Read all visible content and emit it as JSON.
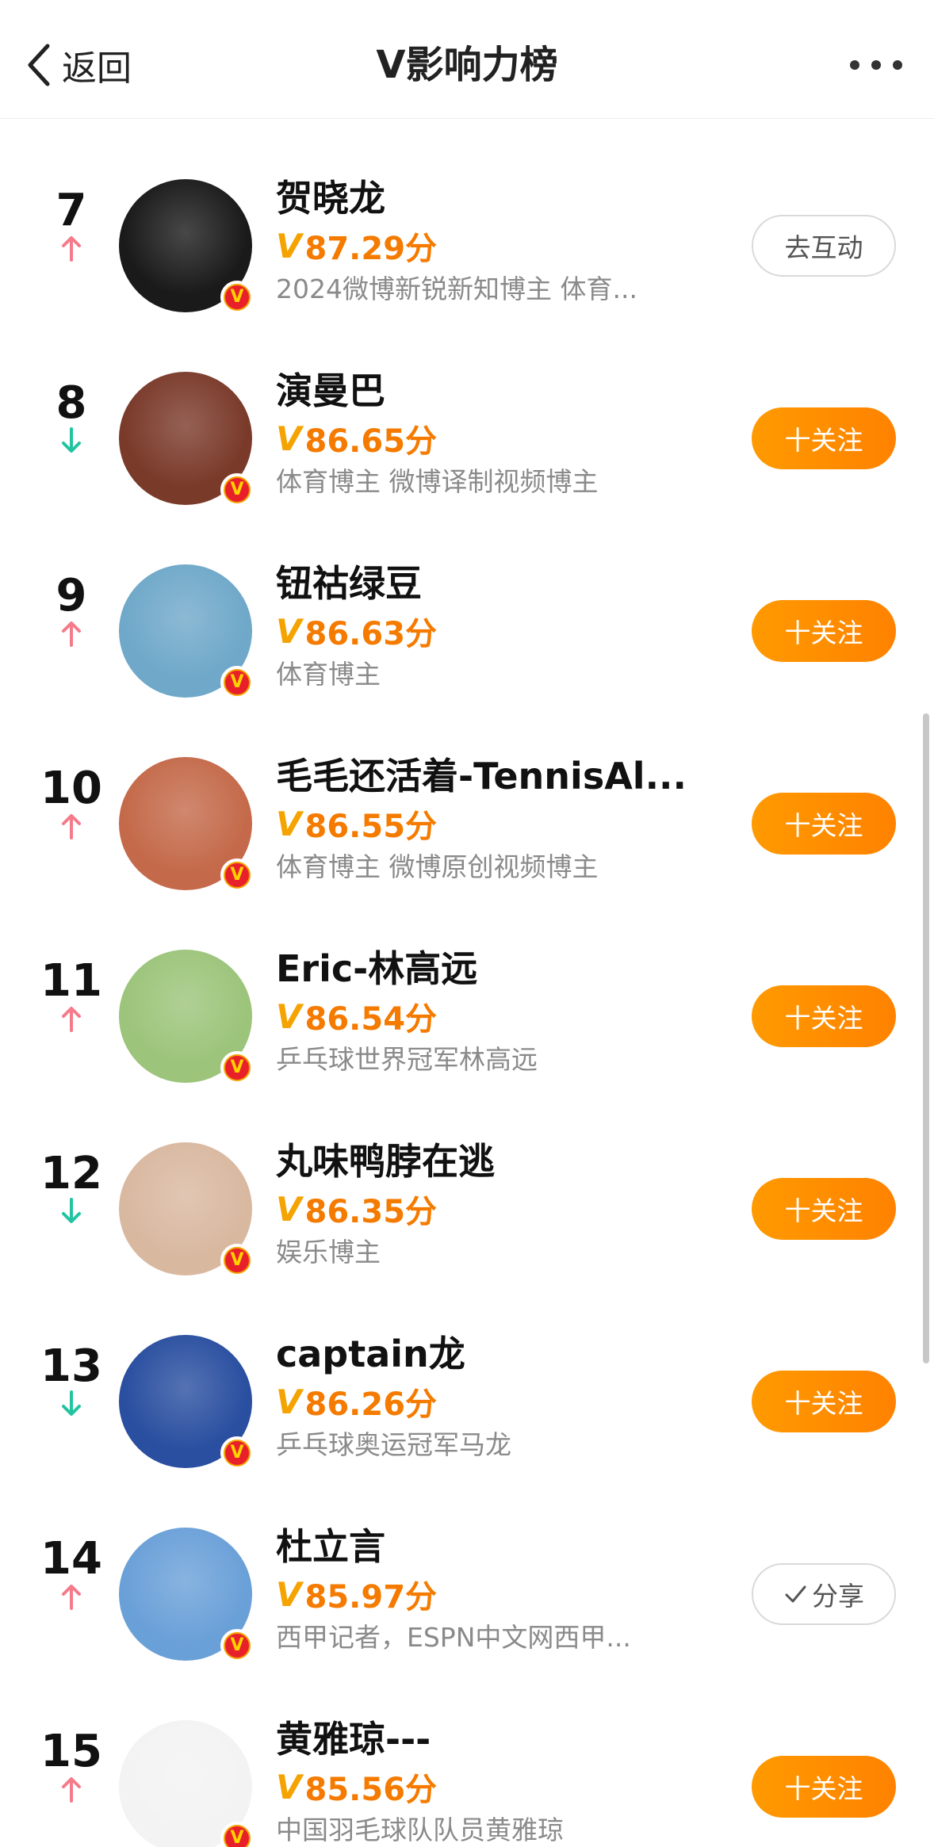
{
  "header": {
    "back_label": "返回",
    "title": "V影响力榜"
  },
  "items": [
    {
      "rank": "7",
      "trend": "up",
      "name": "贺晓龙",
      "score": "87.29分",
      "desc": "2024微博新锐新知博主 体育...",
      "action": "去互动",
      "action_style": "outline",
      "avatar_bg": "#1a1a1a"
    },
    {
      "rank": "8",
      "trend": "down",
      "name": "演曼巴",
      "score": "86.65分",
      "desc": "体育博主 微博译制视频博主",
      "action": "十关注",
      "action_style": "follow",
      "avatar_bg": "#7a3a2a"
    },
    {
      "rank": "9",
      "trend": "up",
      "name": "钮祜绿豆",
      "score": "86.63分",
      "desc": "体育博主",
      "action": "十关注",
      "action_style": "follow",
      "avatar_bg": "#6fa8c9"
    },
    {
      "rank": "10",
      "trend": "up",
      "name": "毛毛还活着-TennisAl...",
      "score": "86.55分",
      "desc": "体育博主 微博原创视频博主",
      "action": "十关注",
      "action_style": "follow",
      "avatar_bg": "#c46a4a"
    },
    {
      "rank": "11",
      "trend": "up",
      "name": "Eric-林高远",
      "score": "86.54分",
      "desc": "乒乓球世界冠军林高远",
      "action": "十关注",
      "action_style": "follow",
      "avatar_bg": "#9cc47a"
    },
    {
      "rank": "12",
      "trend": "down",
      "name": "丸味鸭脖在逃",
      "score": "86.35分",
      "desc": "娱乐博主",
      "action": "十关注",
      "action_style": "follow",
      "avatar_bg": "#d9b8a0"
    },
    {
      "rank": "13",
      "trend": "down",
      "name": "captain龙",
      "score": "86.26分",
      "desc": "乒乓球奥运冠军马龙",
      "action": "十关注",
      "action_style": "follow",
      "avatar_bg": "#2a4fa0"
    },
    {
      "rank": "14",
      "trend": "up",
      "name": "杜立言",
      "score": "85.97分",
      "desc": "西甲记者，ESPN中文网西甲...",
      "action": "分享",
      "action_style": "share",
      "avatar_bg": "#6aa0d8"
    },
    {
      "rank": "15",
      "trend": "up",
      "name": "黄雅琼---",
      "score": "85.56分",
      "desc": "中国羽毛球队队员黄雅琼",
      "action": "十关注",
      "action_style": "follow",
      "avatar_bg": "#f3f3f3"
    }
  ],
  "colors": {
    "up": "#f57a8a",
    "down": "#22c4a0",
    "accent": "#f57b00"
  }
}
